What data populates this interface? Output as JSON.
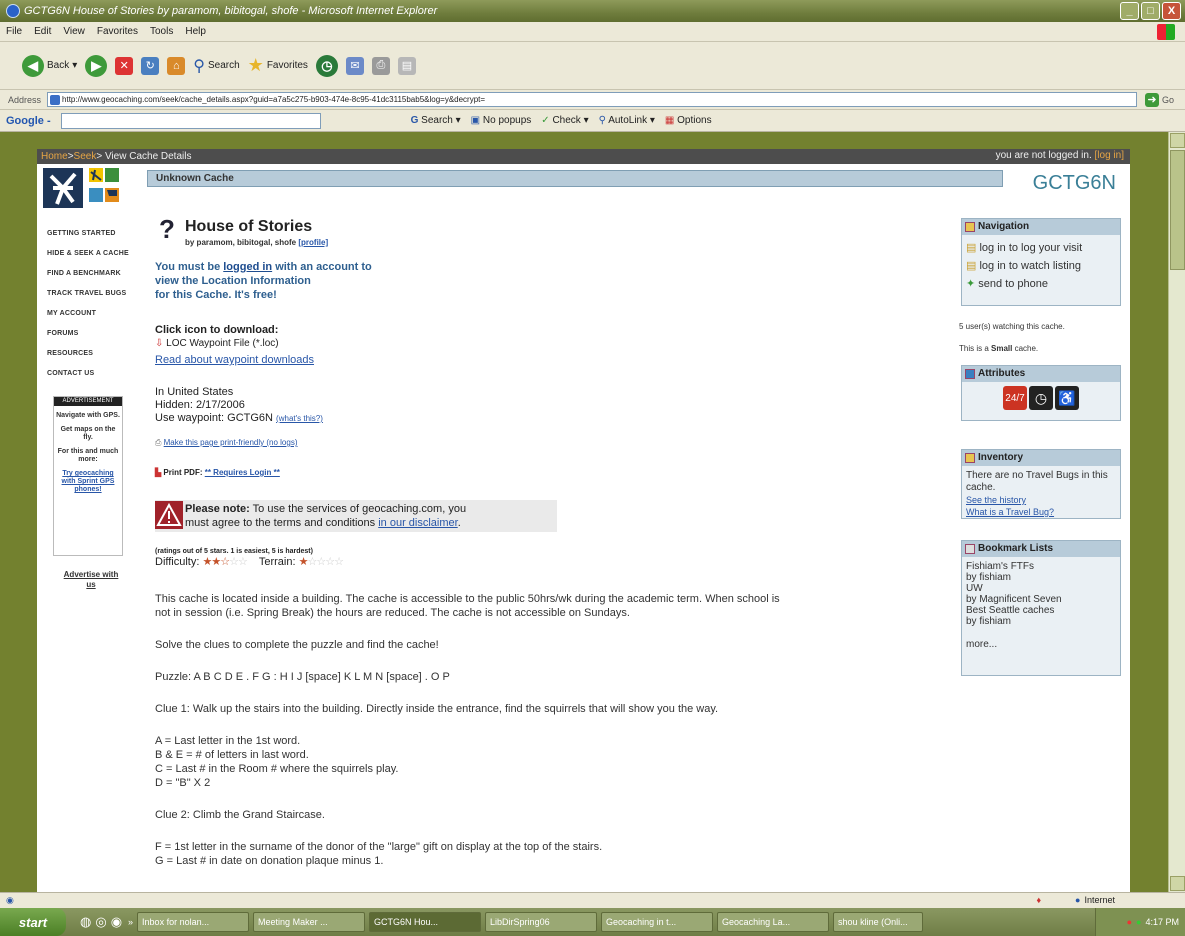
{
  "window": {
    "title": "GCTG6N House of Stories by paramom, bibitogal, shofe - Microsoft Internet Explorer",
    "minimize": "_",
    "maximize": "□",
    "close": "X"
  },
  "menu": [
    "File",
    "Edit",
    "View",
    "Favorites",
    "Tools",
    "Help"
  ],
  "toolbar": {
    "back": "Back",
    "search": "Search",
    "favorites": "Favorites"
  },
  "address": {
    "label": "Address",
    "url": "http://www.geocaching.com/seek/cache_details.aspx?guid=a7a5c275-b903-474e-8c95-41dc3115bab5&log=y&decrypt=",
    "go": "Go"
  },
  "googlebar": {
    "brand": "Google -",
    "search": "Search",
    "popups": "No popups",
    "check": "Check",
    "autolink": "AutoLink",
    "options": "Options"
  },
  "gc": {
    "breadcrumb_home": "Home",
    "breadcrumb_sep1": " > ",
    "breadcrumb_seek": "Seek",
    "breadcrumb_rest": " > View Cache Details",
    "login_text": "you are not logged in.",
    "login_link": "[log in]",
    "cache_type": "Unknown Cache",
    "code": "GCTG6N"
  },
  "leftnav": {
    "items": [
      "GETTING STARTED",
      "HIDE & SEEK A CACHE",
      "FIND A BENCHMARK",
      "TRACK TRAVEL BUGS",
      "MY ACCOUNT",
      "FORUMS",
      "RESOURCES",
      "CONTACT US"
    ],
    "ad_header": "ADVERTISEMENT",
    "ad_line1": "Navigate with GPS.",
    "ad_line2": "Get maps on the fly.",
    "ad_line3": "For this and much more:",
    "ad_link": "Try geocaching with Sprint GPS phones!",
    "advertise": "Advertise with us"
  },
  "cache": {
    "title": "House of Stories",
    "owners": "by paramom, bibitogal, shofe",
    "profile": "[profile]",
    "login_pre": "You must be ",
    "login_link": "logged in",
    "login_post": " with an account to",
    "login_line2": "view the Location Information",
    "login_line3": "for this Cache. It's free!",
    "download_heading": "Click icon to download:",
    "loc_file": "LOC Waypoint File (*.loc)",
    "read_about": "Read about waypoint downloads",
    "location": "In United States",
    "hidden": "Hidden: 2/17/2006",
    "waypoint": "Use waypoint: GCTG6N",
    "whats_this": "(what's this?)",
    "print_friendly": "Make this page print-friendly (no logs)",
    "print_pdf_label": "Print PDF:",
    "print_pdf_link": "** Requires Login **",
    "note_bold": "Please note:",
    "note_text": " To use the services of geocaching.com, you",
    "note_line2": "must agree to the terms and conditions ",
    "note_link": "in our disclaimer",
    "note_end": ".",
    "ratings_note": "(ratings out of 5 stars. 1 is easiest, 5 is hardest)",
    "difficulty_label": "Difficulty:",
    "difficulty_stars": 2.5,
    "terrain_label": "Terrain:",
    "terrain_stars": 1,
    "desc_p1_l1": "This cache is located inside a building. The cache is accessible to the public 50hrs/wk during the academic term. When school is",
    "desc_p1_l2": "not in session (i.e. Spring Break) the hours are reduced. The cache is not accessible on Sundays.",
    "desc_p2": "Solve the clues to complete the puzzle and find the cache!",
    "desc_p3": "Puzzle: A B C D E . F G : H I J [space] K L M N [space] . O P",
    "clue1": "Clue 1: Walk up the stairs into the building. Directly inside the entrance, find the squirrels that will show you the way.",
    "clue1_a": "A = Last letter in the 1st word.",
    "clue1_b": "B & E = # of letters in last word.",
    "clue1_c": "C = Last # in the Room # where the squirrels play.",
    "clue1_d": "D = \"B\" X 2",
    "clue2": "Clue 2: Climb the Grand Staircase.",
    "clue2_f": "F = 1st letter in the surname of the donor of the \"large\" gift on display at the top of the stairs.",
    "clue2_g": "G = Last # in date on donation plaque minus 1."
  },
  "sidebar": {
    "nav_header": "Navigation",
    "nav_items": [
      "log in to log your visit",
      "log in to watch listing",
      "send to phone"
    ],
    "watching": "5 user(s) watching this cache.",
    "size_pre": "This is a ",
    "size_bold": "Small",
    "size_post": " cache.",
    "attributes_header": "Attributes",
    "inventory_header": "Inventory",
    "inventory_text": "There are no Travel Bugs in this cache.",
    "see_history": "See the history",
    "what_is_bug": "What is a Travel Bug?",
    "bookmarks_header": "Bookmark Lists",
    "bookmarks": [
      "Fishiam's FTFs",
      "by fishiam",
      "UW",
      "by Magnificent Seven",
      "Best Seattle caches",
      "by fishiam"
    ],
    "more": "more..."
  },
  "status": {
    "left": "",
    "zone": "Internet"
  },
  "taskbar": {
    "start": "start",
    "items": [
      "Inbox for nolan...",
      "Meeting Maker ...",
      "GCTG6N Hou...",
      "LibDirSpring06",
      "Geocaching in t...",
      "Geocaching La...",
      "shou kline (Onli..."
    ],
    "active_index": 2,
    "desktop": "Desktop",
    "clock": "4:17 PM"
  }
}
